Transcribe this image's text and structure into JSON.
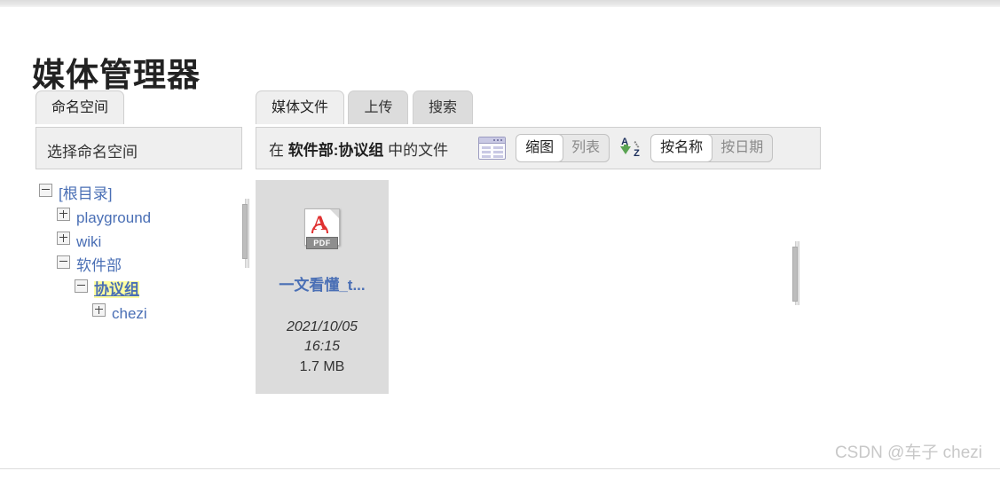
{
  "page": {
    "title": "媒体管理器",
    "watermark": "CSDN @车子 chezi"
  },
  "namespace_panel": {
    "tab_label": "命名空间",
    "header": "选择命名空间",
    "tree": [
      {
        "label": "[根目录]",
        "toggle": "minus",
        "level": 0,
        "current": false
      },
      {
        "label": "playground",
        "toggle": "plus",
        "level": 1,
        "current": false
      },
      {
        "label": "wiki",
        "toggle": "plus",
        "level": 1,
        "current": false
      },
      {
        "label": "软件部",
        "toggle": "minus",
        "level": 1,
        "current": false
      },
      {
        "label": "协议组",
        "toggle": "minus",
        "level": 2,
        "current": true
      },
      {
        "label": "chezi",
        "toggle": "plus",
        "level": 3,
        "current": false
      }
    ]
  },
  "files_panel": {
    "tabs": [
      {
        "label": "媒体文件",
        "active": true
      },
      {
        "label": "上传",
        "active": false
      },
      {
        "label": "搜索",
        "active": false
      }
    ],
    "toolbar": {
      "title_prefix": "在",
      "title_namespace": "软件部:协议组",
      "title_suffix": "中的文件",
      "layout_icon": "window-layout-icon",
      "view_buttons": [
        {
          "label": "缩图",
          "active": true
        },
        {
          "label": "列表",
          "active": false
        }
      ],
      "sort_icon": "sort-az-icon",
      "sort_buttons": [
        {
          "label": "按名称",
          "active": true
        },
        {
          "label": "按日期",
          "active": false
        }
      ]
    },
    "files": [
      {
        "icon": "pdf-file-icon",
        "icon_label": "PDF",
        "name": "一文看懂_t...",
        "date": "2021/10/05",
        "time": "16:15",
        "size": "1.7 MB"
      }
    ]
  },
  "colors": {
    "link": "#4a6fb5",
    "highlight": "#ffffa0",
    "panel_bg": "#efefef",
    "card_bg": "#dcdcdc",
    "pdf_red": "#e03131",
    "sort_green": "#5aa352"
  }
}
